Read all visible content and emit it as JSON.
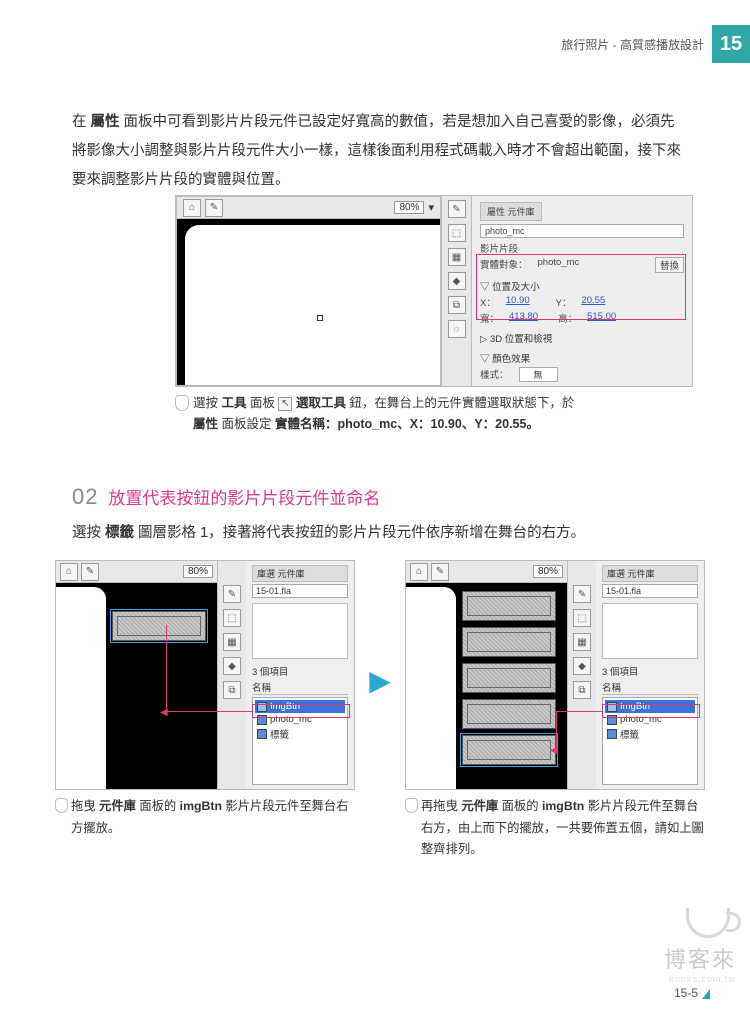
{
  "header": {
    "breadcrumb": "旅行照片 - 高質感播放設計",
    "page_number": "15"
  },
  "intro_paragraph": {
    "p1a": "在 ",
    "p1b": "屬性",
    "p1c": " 面板中可看到影片片段元件已設定好寬高的數值，若是想加入自己喜愛的影像，必須先將影像大小調整與影片片段元件大小一樣，這樣後面利用程式碼載入時才不會超出範圍，接下來要來調整影片片段的實體與位置。"
  },
  "fig1": {
    "zoom": "80%",
    "panel": {
      "tabs": "屬性  元件庫",
      "instance_name": "photo_mc",
      "type": "影片片段",
      "target_label": "實體對象：",
      "target_value": "photo_mc",
      "swap_btn": "替換",
      "section_pos": "▽ 位置及大小",
      "x_label": "X：",
      "x_val": "10.90",
      "y_label": "Y：",
      "y_val": "20.55",
      "w_label": "寬：",
      "w_val": "413.80",
      "h_label": "高：",
      "h_val": "515.00",
      "section_3d": "▷ 3D 位置和檢視",
      "section_color": "▽ 顏色效果",
      "style_label": "樣式：",
      "style_val": "無"
    },
    "caption_a": "選按 ",
    "caption_b": "工具",
    "caption_c": " 面板 ",
    "caption_d": "選取工具",
    "caption_e": " 鈕，在舞台上的元件實體選取狀態下，於 ",
    "caption_f": "屬性",
    "caption_g": " 面板設定 ",
    "caption_h": "實體名稱",
    "caption_i": "：photo_mc、X：10.90、Y：20.55。"
  },
  "step02": {
    "num": "02",
    "title": "放置代表按鈕的影片片段元件並命名",
    "desc_a": "選按 ",
    "desc_b": "標籤",
    "desc_c": " 圖層影格 1，接著將代表按鈕的影片片段元件依序新增在舞台的右方。"
  },
  "fig2": {
    "zoom": "80%",
    "lib_tabs": "庫選  元件庫",
    "file": "15-01.fla",
    "count": "3 個項目",
    "name_header": "名稱",
    "item1": "ImgBtn",
    "item2": "photo_mc",
    "item3": "標籤",
    "cap_a": "拖曳 ",
    "cap_b": "元件庫",
    "cap_c": " 面板的 ",
    "cap_d": "imgBtn",
    "cap_e": " 影片片段元件至舞台右方擺放。"
  },
  "fig3": {
    "cap_a": "再拖曳 ",
    "cap_b": "元件庫",
    "cap_c": " 面板的 ",
    "cap_d": "imgBtn",
    "cap_e": " 影片片段元件至舞台右方，由上而下的擺放，一共要佈置五個，請如上圖整齊排列。"
  },
  "footer": {
    "page": "15-5"
  },
  "watermark": {
    "name": "博客來",
    "sub": "books.com.tw"
  }
}
